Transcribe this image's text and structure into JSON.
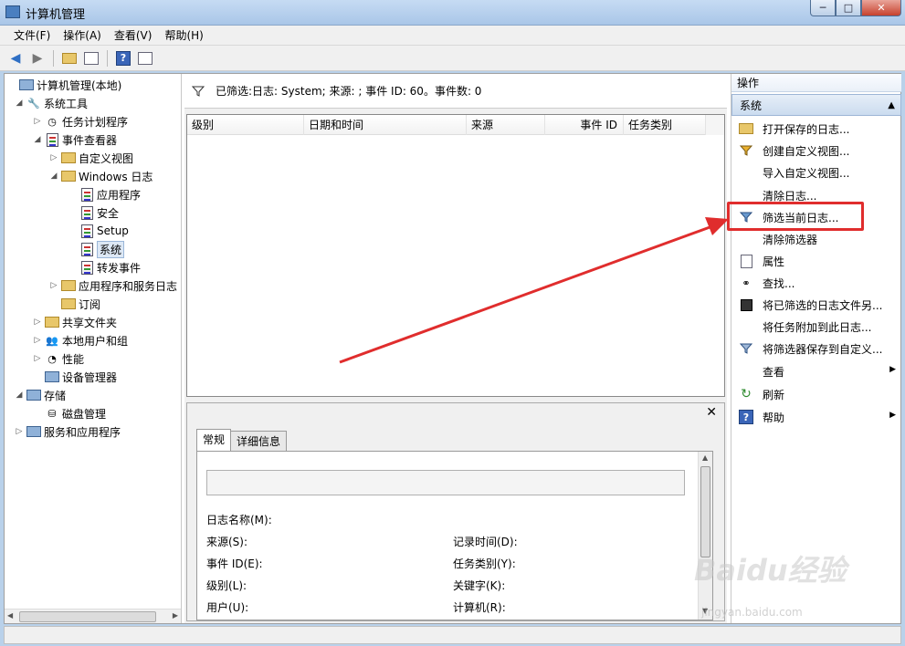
{
  "window": {
    "title": "计算机管理",
    "buttons": {
      "minimize": "─",
      "maximize": "□",
      "close": "✕"
    }
  },
  "menu": [
    "文件(F)",
    "操作(A)",
    "查看(V)",
    "帮助(H)"
  ],
  "tree": {
    "items": [
      {
        "label": "计算机管理(本地)",
        "icon": "computer-icon"
      },
      {
        "label": "系统工具",
        "icon": "tools-icon"
      },
      {
        "label": "任务计划程序",
        "icon": "clock-icon"
      },
      {
        "label": "事件查看器",
        "icon": "event-viewer-icon"
      },
      {
        "label": "自定义视图",
        "icon": "folder-icon"
      },
      {
        "label": "Windows 日志",
        "icon": "folder-icon"
      },
      {
        "label": "应用程序",
        "icon": "log-icon"
      },
      {
        "label": "安全",
        "icon": "log-icon"
      },
      {
        "label": "Setup",
        "icon": "log-icon"
      },
      {
        "label": "系统",
        "icon": "log-icon"
      },
      {
        "label": "转发事件",
        "icon": "log-icon"
      },
      {
        "label": "应用程序和服务日志",
        "icon": "folder-icon"
      },
      {
        "label": "订阅",
        "icon": "subscription-icon"
      },
      {
        "label": "共享文件夹",
        "icon": "shared-folder-icon"
      },
      {
        "label": "本地用户和组",
        "icon": "users-icon"
      },
      {
        "label": "性能",
        "icon": "performance-icon"
      },
      {
        "label": "设备管理器",
        "icon": "device-manager-icon"
      },
      {
        "label": "存储",
        "icon": "storage-icon"
      },
      {
        "label": "磁盘管理",
        "icon": "disk-icon"
      },
      {
        "label": "服务和应用程序",
        "icon": "services-icon"
      }
    ]
  },
  "filter": {
    "text": "已筛选:日志: System; 来源: ; 事件 ID: 60。事件数: 0"
  },
  "columns": [
    "级别",
    "日期和时间",
    "来源",
    "事件 ID",
    "任务类别"
  ],
  "detail": {
    "tabs": [
      "常规",
      "详细信息"
    ],
    "close": "✕",
    "fields": {
      "log_name": "日志名称(M):",
      "source": "来源(S):",
      "event_id": "事件 ID(E):",
      "level": "级别(L):",
      "user": "用户(U):",
      "logged": "记录时间(D):",
      "task_category": "任务类别(Y):",
      "keywords": "关键字(K):",
      "computer": "计算机(R):"
    }
  },
  "actions": {
    "header": "操作",
    "section": "系统",
    "items": [
      {
        "label": "打开保存的日志...",
        "icon": "open-folder-icon"
      },
      {
        "label": "创建自定义视图...",
        "icon": "filter-create-icon"
      },
      {
        "label": "导入自定义视图...",
        "icon": ""
      },
      {
        "label": "清除日志...",
        "icon": ""
      },
      {
        "label": "筛选当前日志...",
        "icon": "filter-icon"
      },
      {
        "label": "清除筛选器",
        "icon": ""
      },
      {
        "label": "属性",
        "icon": "properties-icon"
      },
      {
        "label": "查找...",
        "icon": "binoculars-icon"
      },
      {
        "label": "将已筛选的日志文件另...",
        "icon": "save-icon"
      },
      {
        "label": "将任务附加到此日志...",
        "icon": ""
      },
      {
        "label": "将筛选器保存到自定义...",
        "icon": "save-filter-icon"
      },
      {
        "label": "查看",
        "icon": ""
      },
      {
        "label": "刷新",
        "icon": "refresh-icon"
      },
      {
        "label": "帮助",
        "icon": "help-icon"
      }
    ]
  },
  "watermark": {
    "brand": "Baidu经验",
    "url": "jingyan.baidu.com"
  },
  "colors": {
    "highlight": "#e02d2d",
    "arrow": "#e02d2d",
    "accent": "#3a65b8"
  }
}
